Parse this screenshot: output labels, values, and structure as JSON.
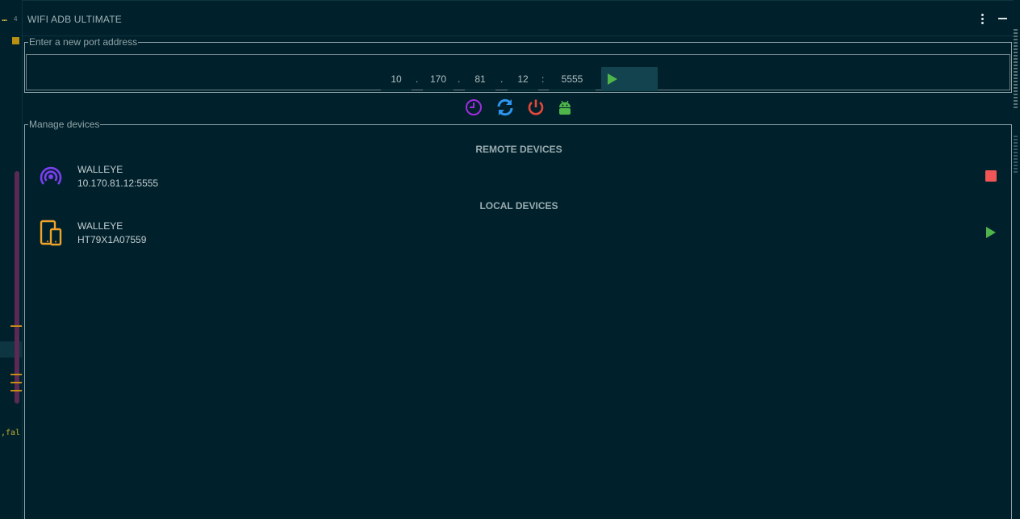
{
  "editor": {
    "gutter_dots": "...",
    "gutter_number": "4",
    "gutter_code": ",fal"
  },
  "panel": {
    "title": "WIFI ADB ULTIMATE"
  },
  "port": {
    "legend": "Enter a new port address",
    "ip": [
      "10",
      "170",
      "81",
      "12"
    ],
    "port": "5555",
    "dot_separator": ".",
    "colon_separator": ":"
  },
  "toolbar": {
    "icons": [
      "history-icon",
      "refresh-icon",
      "power-icon",
      "android-icon"
    ],
    "colors": {
      "history": "#a12be0",
      "refresh": "#2e96f0",
      "power": "#e8473b",
      "android": "#4fb54a"
    }
  },
  "devices": {
    "legend": "Manage devices",
    "remote_title": "REMOTE DEVICES",
    "local_title": "LOCAL DEVICES",
    "remote": [
      {
        "name": "WALLEYE",
        "address": "10.170.81.12:5555",
        "icon": "wifi-broadcast-icon",
        "action": "stop"
      }
    ],
    "local": [
      {
        "name": "WALLEYE",
        "serial": "HT79X1A07559",
        "icon": "phone-tablet-icon",
        "action": "play"
      }
    ]
  },
  "colors": {
    "background": "#00212b",
    "play_green": "#4fb54a",
    "stop_red": "#f25555",
    "remote_icon": "#7b3ef0",
    "local_icon": "#f0a22a"
  }
}
